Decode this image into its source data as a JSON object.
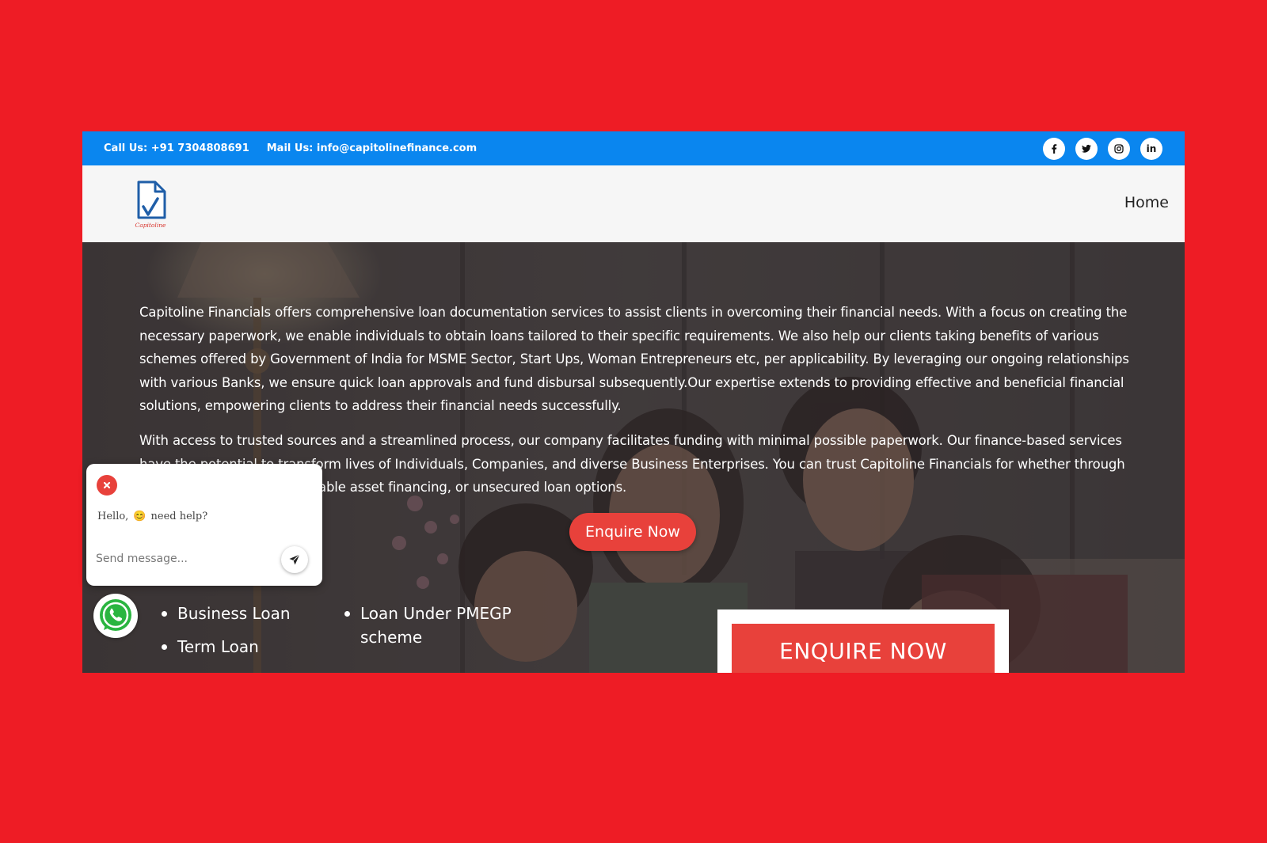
{
  "colors": {
    "backdrop": "#ee1c25",
    "topbar": "#0a86ef",
    "header": "#f6f6f6",
    "accent_red": "#e8413b",
    "hero_overlay": "#2e2a2b",
    "whatsapp_green": "#2ab540"
  },
  "topbar": {
    "phone": "Call Us: +91 7304808691",
    "email": "Mail Us: info@capitolinefinance.com",
    "socials": [
      {
        "name": "facebook",
        "icon": "facebook-icon"
      },
      {
        "name": "twitter",
        "icon": "twitter-icon"
      },
      {
        "name": "instagram",
        "icon": "instagram-icon"
      },
      {
        "name": "linkedin",
        "icon": "linkedin-icon",
        "glyph": "in"
      }
    ]
  },
  "header": {
    "logo_text": "Capitoline",
    "nav": {
      "home": "Home"
    }
  },
  "hero": {
    "paragraph_1": "Capitoline Financials offers comprehensive loan documentation services to assist clients in overcoming their financial needs. With a focus on creating the necessary paperwork, we enable individuals to obtain loans tailored to their specific requirements. We also help our clients taking benefits of various schemes offered by Government of India for MSME Sector, Start Ups, Woman Entrepreneurs etc, per applicability. By leveraging our ongoing relationships with various Banks, we ensure quick loan approvals and fund disbursal subsequently.Our expertise extends to providing effective and beneficial financial solutions, empowering clients to address their financial needs successfully.",
    "paragraph_2": "With access to trusted sources and a streamlined process, our company facilitates funding with minimal possible paperwork. Our finance-based services have the potential to transform lives of Individuals, Companies, and diverse Business Enterprises. You can trust Capitoline Financials for whether through property-backed loans, valuable asset financing, or unsecured loan options.",
    "enquire_label": "Enquire Now",
    "services_left": [
      "Business Loan",
      "Term Loan"
    ],
    "services_right": [
      "Loan Under PMEGP scheme"
    ],
    "enquire_box_label": "ENQUIRE NOW"
  },
  "chat": {
    "greeting_prefix": "Hello,",
    "greeting_emoji": "😊",
    "greeting_suffix": "need help?",
    "placeholder": "Send message..."
  }
}
